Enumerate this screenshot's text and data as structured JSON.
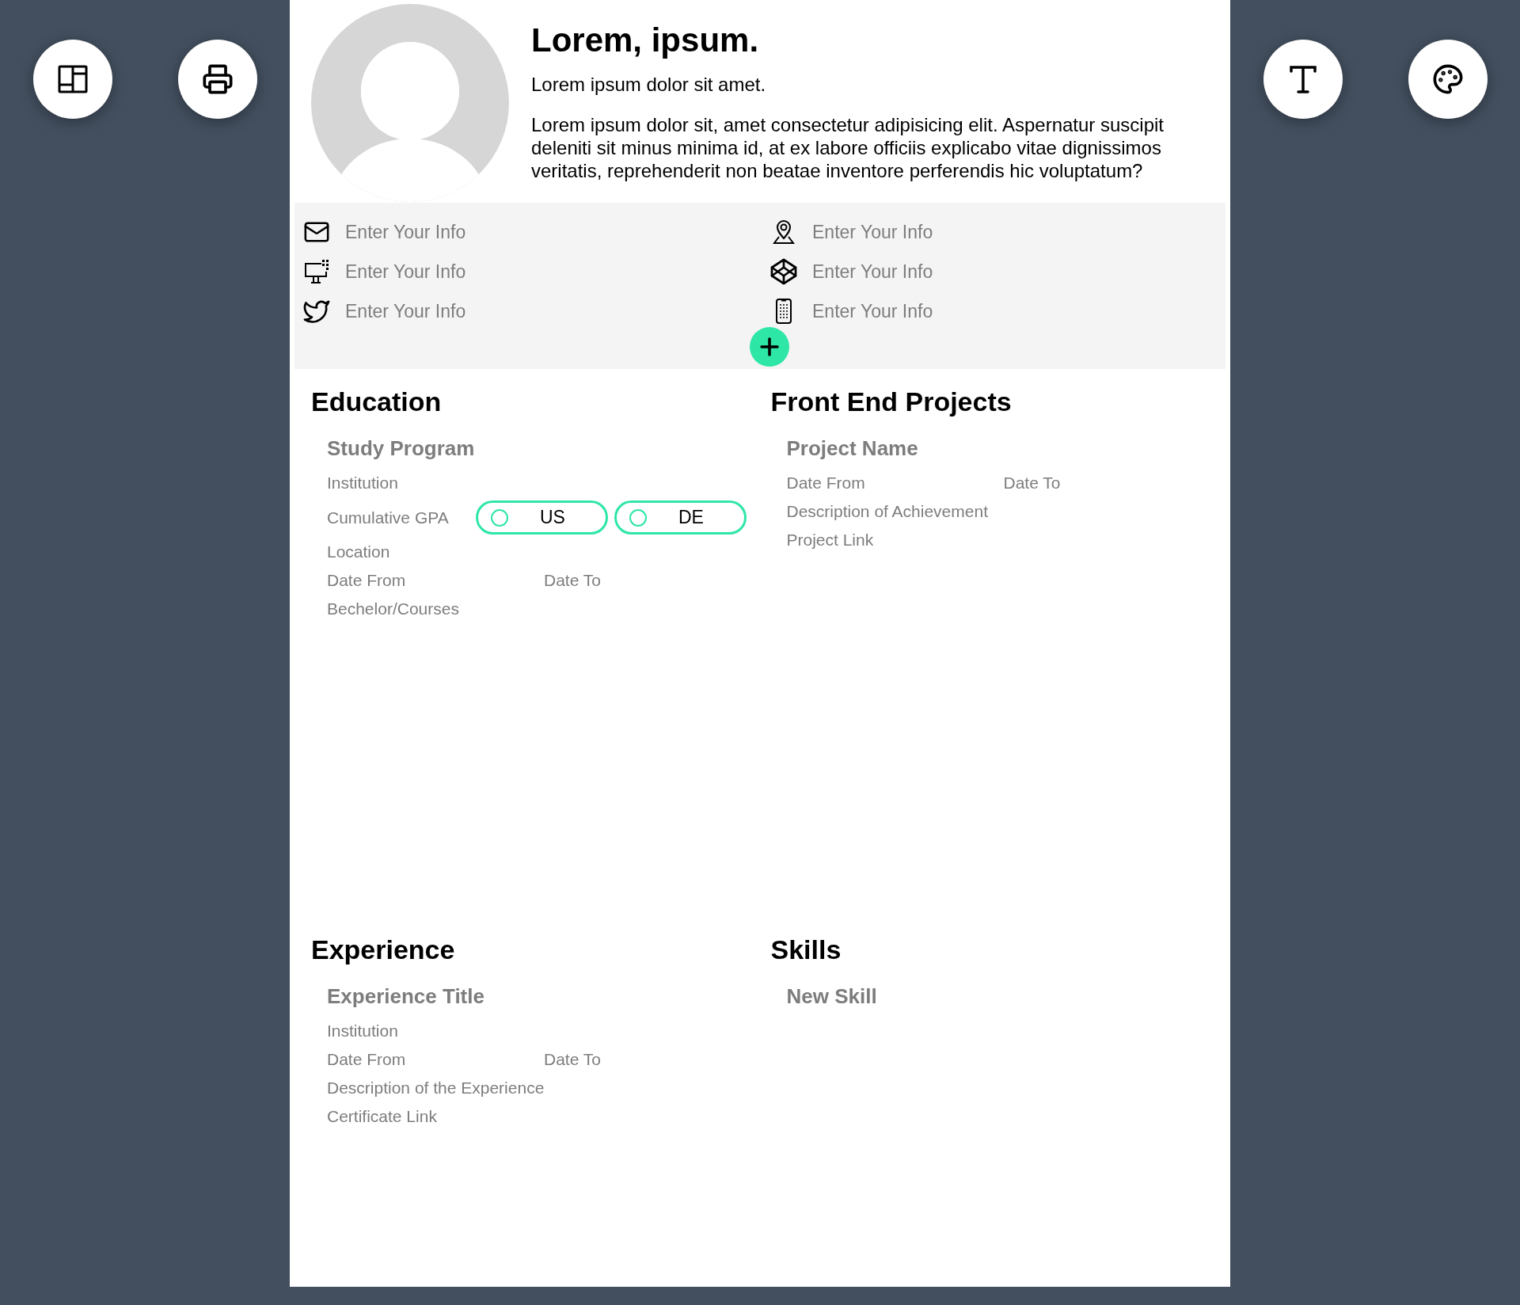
{
  "profile": {
    "name": "Lorem, ipsum.",
    "subtitle": "Lorem ipsum dolor sit amet.",
    "bio": "Lorem ipsum dolor sit, amet consectetur adipisicing elit. Aspernatur suscipit deleniti sit minus minima id, at ex labore officiis explicabo vitae dignissimos veritatis, reprehenderit non beatae inventore perferendis hic voluptatum?"
  },
  "contacts": [
    {
      "kind": "email",
      "placeholder": "Enter Your Info"
    },
    {
      "kind": "location",
      "placeholder": "Enter Your Info"
    },
    {
      "kind": "website",
      "placeholder": "Enter Your Info"
    },
    {
      "kind": "codepen",
      "placeholder": "Enter Your Info"
    },
    {
      "kind": "twitter",
      "placeholder": "Enter Your Info"
    },
    {
      "kind": "phone",
      "placeholder": "Enter Your Info"
    }
  ],
  "sections": [
    {
      "title": "Education",
      "entries": [
        {
          "kind": "heading",
          "placeholder": "Study Program"
        },
        {
          "kind": "text",
          "placeholder": "Institution"
        },
        {
          "kind": "gpa",
          "placeholder": "Cumulative GPA",
          "options": [
            {
              "label": "US",
              "selected": false
            },
            {
              "label": "DE",
              "selected": false
            }
          ]
        },
        {
          "kind": "text",
          "placeholder": "Location"
        },
        {
          "kind": "dates",
          "placeholder": "Date From",
          "placeholder_end": "Date To"
        },
        {
          "kind": "text",
          "placeholder": "Bechelor/Courses"
        }
      ]
    },
    {
      "title": "Front End Projects",
      "entries": [
        {
          "kind": "heading",
          "placeholder": "Project Name"
        },
        {
          "kind": "dates",
          "placeholder": "Date From",
          "placeholder_end": "Date To"
        },
        {
          "kind": "text",
          "placeholder": "Description of Achievement"
        },
        {
          "kind": "text",
          "placeholder": "Project Link"
        }
      ]
    },
    {
      "title": "Experience",
      "entries": [
        {
          "kind": "heading",
          "placeholder": "Experience Title"
        },
        {
          "kind": "text",
          "placeholder": "Institution"
        },
        {
          "kind": "dates",
          "placeholder": "Date From",
          "placeholder_end": "Date To"
        },
        {
          "kind": "text",
          "placeholder": "Description of the Experience"
        },
        {
          "kind": "text",
          "placeholder": "Certificate Link"
        }
      ]
    },
    {
      "title": "Skills",
      "entries": [
        {
          "kind": "heading",
          "placeholder": "New Skill"
        }
      ]
    }
  ]
}
